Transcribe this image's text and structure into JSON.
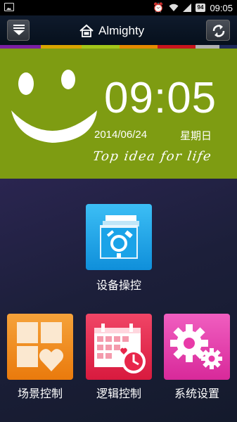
{
  "status_bar": {
    "battery": "94",
    "time": "09:05"
  },
  "header": {
    "title": "Almighty",
    "icons": {
      "menu": "menu-dropdown-icon",
      "home": "home-icon",
      "refresh": "refresh-icon"
    }
  },
  "stripe_colors": [
    "#7a1fa2",
    "#d9a400",
    "#a3c61a",
    "#e58a00",
    "#c8151c",
    "#b0b0b0",
    "#1e2a5a"
  ],
  "hero": {
    "background": "#7e9c12",
    "time": "09:05",
    "date": "2014/06/24",
    "weekday": "星期日",
    "slogan": "Top idea for life",
    "icon": "smiley-face-icon"
  },
  "tiles": [
    {
      "label": "设备操控",
      "icon": "device-control-icon",
      "color": "#1aa3e8"
    },
    {
      "label": "场景控制",
      "icon": "scene-control-icon",
      "color": "#f18a14"
    },
    {
      "label": "逻辑控制",
      "icon": "logic-calendar-icon",
      "color": "#e8264a"
    },
    {
      "label": "系统设置",
      "icon": "system-settings-icon",
      "color": "#e83aa8"
    }
  ]
}
